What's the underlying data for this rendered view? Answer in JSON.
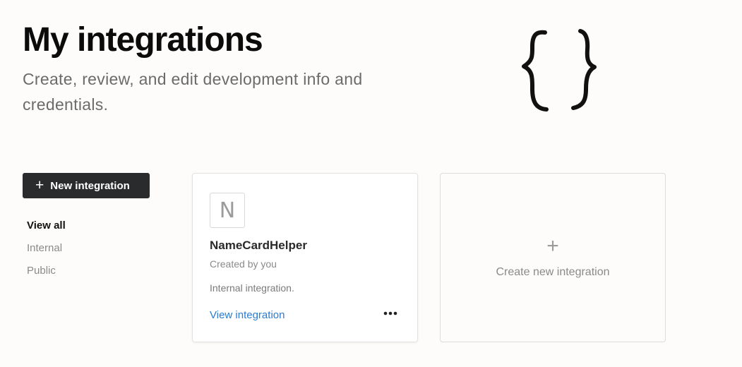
{
  "header": {
    "title": "My integrations",
    "subtitle": "Create, review, and edit development info and credentials."
  },
  "sidebar": {
    "new_button": {
      "icon": "plus-icon",
      "icon_glyph": "+",
      "label": "New integration"
    },
    "filters": [
      {
        "label": "View all",
        "active": true
      },
      {
        "label": "Internal",
        "active": false
      },
      {
        "label": "Public",
        "active": false
      }
    ]
  },
  "integrations": [
    {
      "logo_letter": "N",
      "name": "NameCardHelper",
      "created_by": "Created by you",
      "description": "Internal integration.",
      "link_label": "View integration",
      "more_icon": "more-horizontal-icon"
    }
  ],
  "create_card": {
    "icon": "plus-icon",
    "icon_glyph": "+",
    "label": "Create new integration"
  },
  "illustration": {
    "icon": "curly-braces-icon"
  },
  "colors": {
    "link": "#2a7bd1",
    "button_bg": "#2a2b2c",
    "page_bg": "#fdfcfb"
  }
}
